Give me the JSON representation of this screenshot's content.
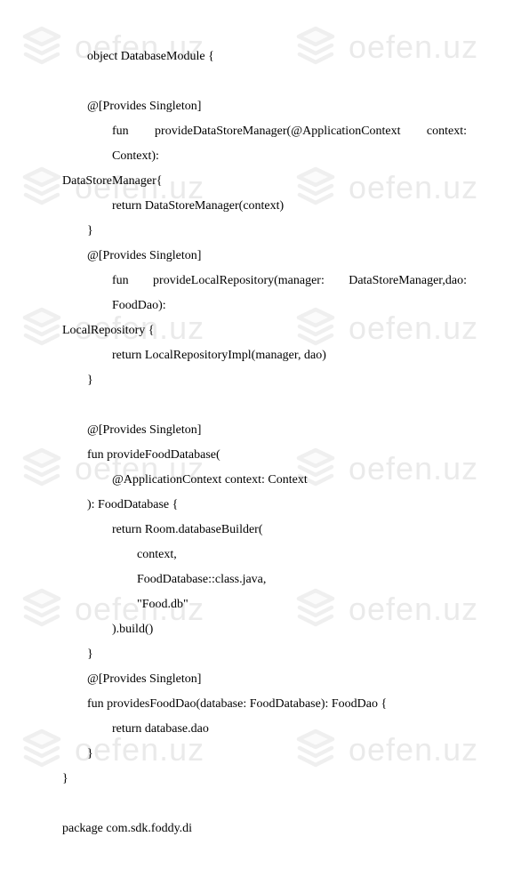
{
  "watermark": {
    "text": "oefen.uz"
  },
  "code": {
    "l1": "object DatabaseModule {",
    "l2": "@[Provides Singleton]",
    "l3a": "fun",
    "l3b": "provideDataStoreManager(@ApplicationContext",
    "l3c": "context:",
    "l3d": "Context):",
    "l4": "DataStoreManager{",
    "l5": "return DataStoreManager(context)",
    "l6": "}",
    "l7": "@[Provides Singleton]",
    "l8": "fun provideLocalRepository(manager: DataStoreManager,dao: FoodDao):",
    "l9": "LocalRepository {",
    "l10": "return LocalRepositoryImpl(manager, dao)",
    "l11": "}",
    "l12": "@[Provides Singleton]",
    "l13": "fun provideFoodDatabase(",
    "l14": "@ApplicationContext context: Context",
    "l15": "): FoodDatabase {",
    "l16": "return Room.databaseBuilder(",
    "l17": "context,",
    "l18": "FoodDatabase::class.java,",
    "l19": "\"Food.db\"",
    "l20": ").build()",
    "l21": "}",
    "l22": "@[Provides Singleton]",
    "l23": "fun providesFoodDao(database: FoodDatabase): FoodDao {",
    "l24": "return database.dao",
    "l25": "}",
    "l26": "}",
    "l27": "package com.sdk.foddy.di"
  }
}
